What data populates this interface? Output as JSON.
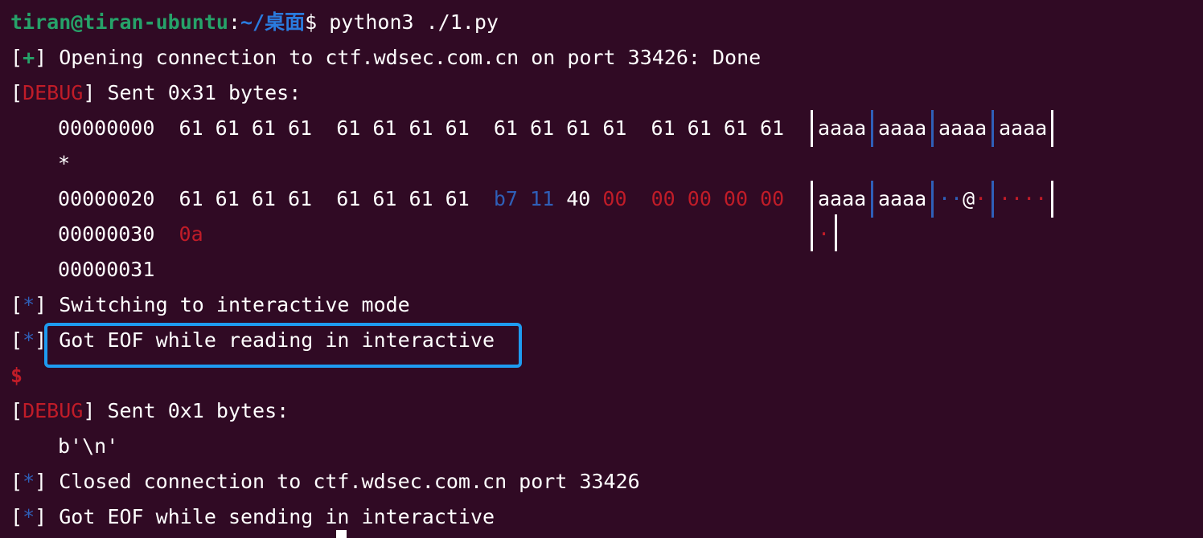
{
  "prompt": {
    "user_host": "tiran@tiran-ubuntu",
    "sep": ":",
    "path": "~/桌面",
    "dollar": "$",
    "command": " python3 ./1.py"
  },
  "lines": {
    "open_prefix": "+",
    "open_text": " Opening connection to ctf.wdsec.com.cn on port 33426: Done",
    "debug_tag": "DEBUG",
    "sent1": " Sent 0x31 bytes:",
    "hex1_offset": "00000000",
    "hex1_bytes": "61 61 61 61  61 61 61 61  61 61 61 61  61 61 61 61",
    "ascii1": [
      "aaaa",
      "aaaa",
      "aaaa",
      "aaaa"
    ],
    "star": "*",
    "hex2_offset": "00000020",
    "hex2_bytes_a": "61 61 61 61  61 61 61 61  ",
    "hex2_b7": "b7",
    "hex2_11": "11",
    "hex2_40": "40",
    "hex2_00a": "00",
    "hex2_00b": "00 00 00 00",
    "ascii2_a": "aaaa",
    "ascii2_b": "aaaa",
    "ascii2_c1": "··",
    "ascii2_c2": "@",
    "ascii2_c3": "·",
    "ascii2_d": "····",
    "hex3_offset": "00000030",
    "hex3_bytes": "0a",
    "ascii3": "·",
    "hex4_offset": "00000031",
    "star_prefix": "*",
    "switch_text": " Switching to interactive mode",
    "eof_read_text": " Got EOF while reading in interactive",
    "prompt_dollar": "$",
    "sent2": " Sent 0x1 bytes:",
    "bytes_repr": "b'\\n'",
    "closed_text": " Closed connection to ctf.wdsec.com.cn port 33426",
    "eof_send_text": " Got EOF while sending in interactive"
  }
}
